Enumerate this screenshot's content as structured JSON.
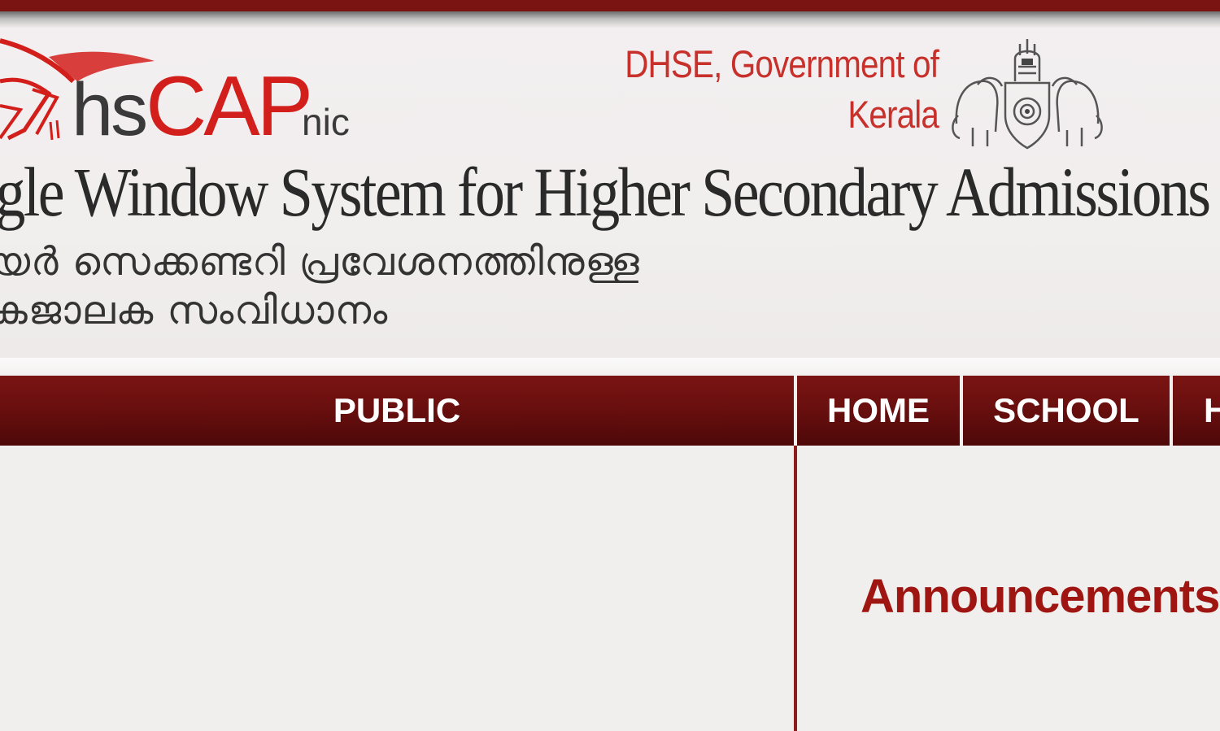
{
  "header": {
    "logo": {
      "hs": "hs",
      "cap": "CAP",
      "nic": "nic"
    },
    "dhse_line1": "DHSE, Government of",
    "dhse_line2": "Kerala",
    "title_en": "ngle Window System for Higher Secondary Admissions",
    "title_ml_line1": "യർ സെക്കണ്ടറി പ്രവേശനത്തിനുള്ള",
    "title_ml_line2": "കജാലക സംവിധാനം"
  },
  "nav": {
    "public_label": "PUBLIC",
    "home_label": "HOME",
    "school_label": "SCHOOL",
    "next_label": "H"
  },
  "main": {
    "announcements_heading": "Announcements"
  },
  "colors": {
    "brand_red": "#d21f1b",
    "nav_dark_red": "#6a0f0f",
    "heading_red": "#9e1512"
  }
}
